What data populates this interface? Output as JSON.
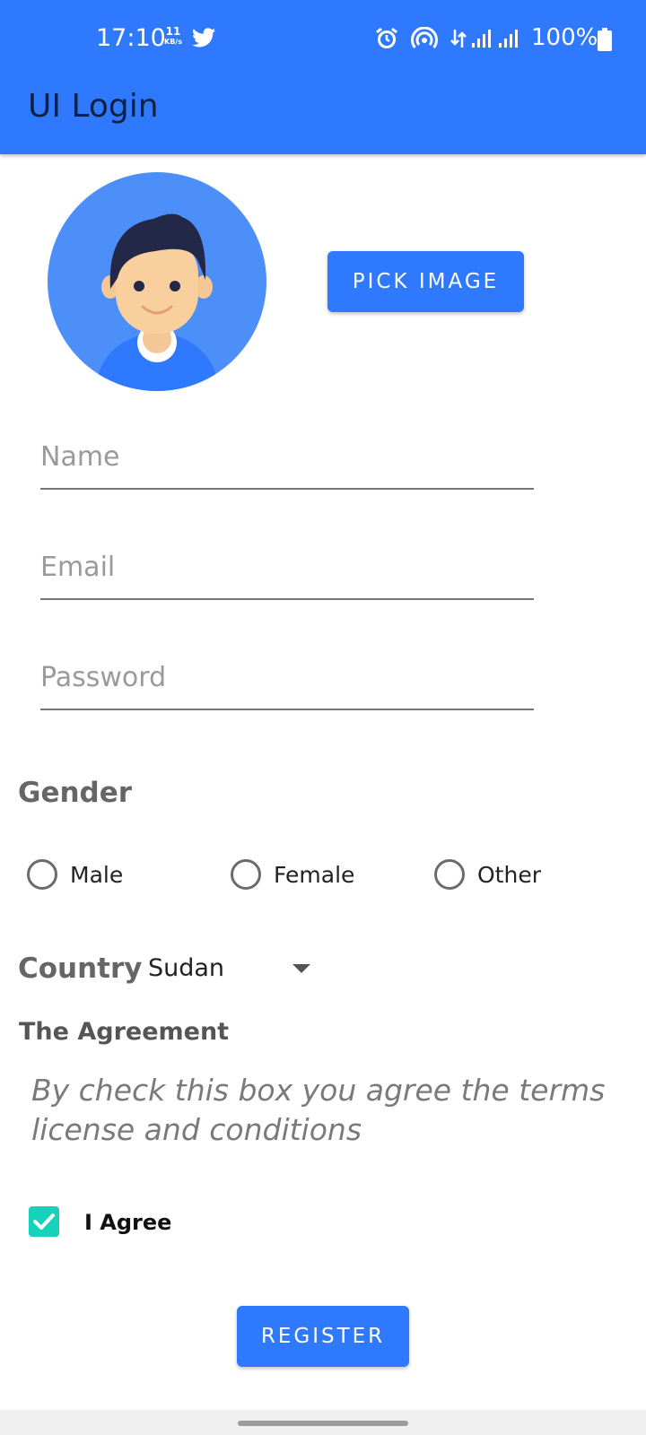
{
  "status_bar": {
    "time": "17:10",
    "net_speed_value": "11",
    "net_speed_unit": "KB/s",
    "battery": "100%",
    "icons": [
      "twitter-icon",
      "alarm-icon",
      "hotspot-icon",
      "data-transfer-icon",
      "signal-icon",
      "signal-icon",
      "battery-icon"
    ]
  },
  "app_bar": {
    "title": "UI Login"
  },
  "profile": {
    "avatar_icon": "avatar-illustration",
    "pick_image_label": "PICK IMAGE"
  },
  "form": {
    "name_placeholder": "Name",
    "name_value": "",
    "email_placeholder": "Email",
    "email_value": "",
    "password_placeholder": "Password",
    "password_value": ""
  },
  "gender": {
    "label": "Gender",
    "options": [
      {
        "label": "Male",
        "selected": false
      },
      {
        "label": "Female",
        "selected": false
      },
      {
        "label": "Other",
        "selected": false
      }
    ]
  },
  "country": {
    "label": "Country",
    "selected": "Sudan"
  },
  "agreement": {
    "title": "The Agreement",
    "text": "By check this box you agree the terms license and conditions",
    "checkbox_label": "I Agree",
    "checked": true
  },
  "register_label": "REGISTER",
  "colors": {
    "primary": "#2f79ff",
    "checkbox_accent": "#17d2bb",
    "avatar_bg": "#4d8ff9"
  }
}
